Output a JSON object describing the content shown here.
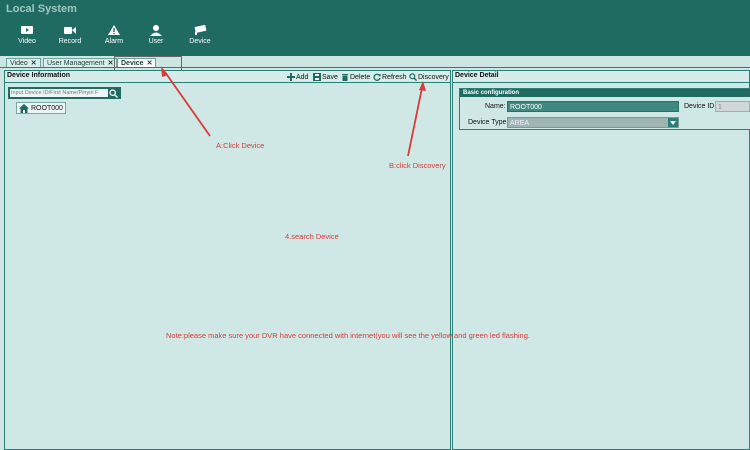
{
  "app": {
    "title": "Local System"
  },
  "nav": [
    {
      "label": "Video",
      "icon": "video-icon"
    },
    {
      "label": "Record",
      "icon": "record-icon"
    },
    {
      "label": "Alarm",
      "icon": "alarm-icon"
    },
    {
      "label": "User",
      "icon": "user-icon"
    },
    {
      "label": "Device",
      "icon": "device-icon"
    }
  ],
  "tabs": [
    {
      "label": "Video",
      "active": false
    },
    {
      "label": "User Management",
      "active": false
    },
    {
      "label": "Device",
      "active": true
    }
  ],
  "left_panel": {
    "title": "Device Information",
    "toolbar": {
      "add": "Add",
      "save": "Save",
      "delete": "Delete",
      "refresh": "Refresh",
      "discovery": "Discovery"
    },
    "search_placeholder": "Input Device ID/First Name/Pinyin F",
    "tree_root": "ROOT000"
  },
  "right_panel": {
    "title": "Device Detail",
    "section_title": "Basic configuration",
    "name_label": "Name:",
    "name_value": "ROOT000",
    "device_id_label": "Device ID:",
    "device_id_value": "1",
    "device_type_label": "Device Type:",
    "device_type_value": "AREA"
  },
  "annotations": {
    "a": "A:Click Device",
    "b": "B:click Discovery",
    "c": "4.search Device",
    "note": "Note:please make sure your DVR have connected with internet(you will see the yellow and green led flashing."
  },
  "colors": {
    "header": "#1f6b62",
    "panel_bg": "#cfe8e5",
    "annotation": "#d93a3a"
  }
}
